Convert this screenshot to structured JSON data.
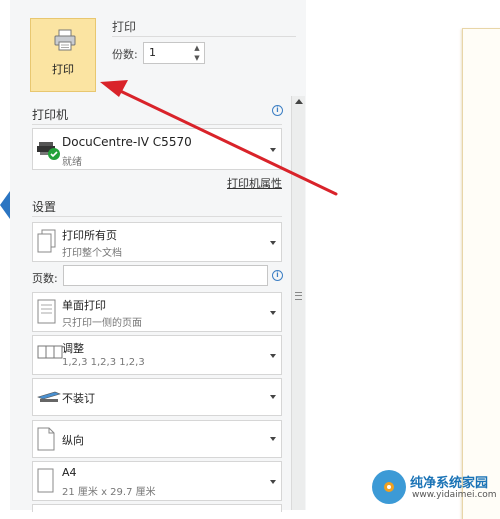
{
  "print_section": {
    "button_label": "打印",
    "title": "打印",
    "copies_label": "份数:",
    "copies_value": "1"
  },
  "printer_section": {
    "title": "打印机",
    "printer_name": "DocuCentre-IV C5570",
    "printer_status": "就绪",
    "properties_link": "打印机属性"
  },
  "settings_section": {
    "title": "设置",
    "pages_label": "页数:",
    "pages_value": "",
    "dropdowns": [
      {
        "main": "打印所有页",
        "sub": "打印整个文档"
      },
      {
        "main": "单面打印",
        "sub": "只打印一侧的页面"
      },
      {
        "main": "调整",
        "sub": "1,2,3    1,2,3    1,2,3"
      },
      {
        "main": "不装订",
        "sub": ""
      },
      {
        "main": "纵向",
        "sub": ""
      },
      {
        "main": "A4",
        "sub": "21 厘米 x 29.7 厘米"
      }
    ]
  },
  "watermark": {
    "title": "纯净系统家园",
    "url": "www.yidaimei.com"
  },
  "colors": {
    "accent": "#2b75c2",
    "print_button_bg": "#fbe4a2",
    "annotation_arrow": "#d9232a",
    "panel_bg": "#f5f6f7"
  }
}
